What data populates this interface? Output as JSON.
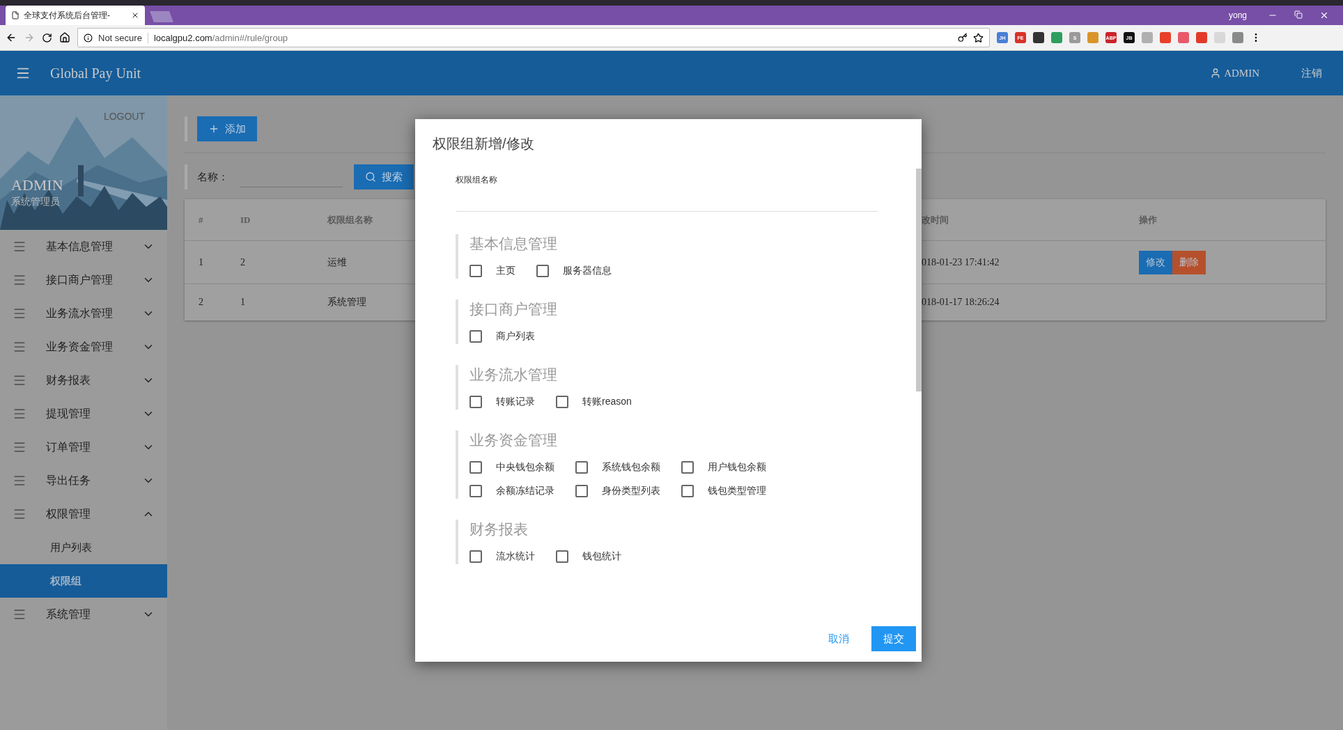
{
  "browser": {
    "tab_title": "全球支付系统后台管理-",
    "security": "Not secure",
    "url_host": "localgpu2.com",
    "url_path": "/admin#/rule/group",
    "profile": "yong",
    "extensions": [
      {
        "text": "JH",
        "color": "#4a7fd6"
      },
      {
        "text": "FE",
        "color": "#d8322a"
      },
      {
        "color": "#333333"
      },
      {
        "color": "#2e9e5e"
      },
      {
        "text": "S",
        "color": "#9a9a9a"
      },
      {
        "color": "#d9952b"
      },
      {
        "text": "ABP",
        "color": "#c9252b"
      },
      {
        "text": "JB",
        "color": "#111111"
      },
      {
        "color": "#b0b0b0"
      },
      {
        "color": "#e8402a"
      },
      {
        "color": "#e85a6a"
      },
      {
        "color": "#e23a2a"
      },
      {
        "color": "#d8d8d8"
      },
      {
        "color": "#8a8a8a"
      }
    ]
  },
  "header": {
    "title": "Global Pay Unit",
    "user": "ADMIN",
    "logout": "注销"
  },
  "profile": {
    "logout": "LOGOUT",
    "name": "ADMIN",
    "role": "系统管理员"
  },
  "sidebar": {
    "items": [
      {
        "label": "基本信息管理",
        "expanded": false
      },
      {
        "label": "接口商户管理",
        "expanded": false
      },
      {
        "label": "业务流水管理",
        "expanded": false
      },
      {
        "label": "业务资金管理",
        "expanded": false
      },
      {
        "label": "财务报表",
        "expanded": false
      },
      {
        "label": "提现管理",
        "expanded": false
      },
      {
        "label": "订单管理",
        "expanded": false
      },
      {
        "label": "导出任务",
        "expanded": false
      },
      {
        "label": "权限管理",
        "expanded": true,
        "children": [
          {
            "label": "用户列表",
            "selected": false
          },
          {
            "label": "权限组",
            "selected": true
          }
        ]
      },
      {
        "label": "系统管理",
        "expanded": false
      }
    ]
  },
  "toolbar": {
    "add_button": "添加",
    "search_label": "名称：",
    "search_button": "搜索"
  },
  "table": {
    "columns": [
      "#",
      "ID",
      "权限组名称",
      "改时间",
      "操作"
    ],
    "rows": [
      {
        "cells": [
          "1",
          "2",
          "运维",
          "018-01-23 17:41:42"
        ],
        "actions": [
          {
            "label": "修改",
            "kind": "edit"
          },
          {
            "label": "删除",
            "kind": "delete"
          }
        ]
      },
      {
        "cells": [
          "2",
          "1",
          "系统管理",
          "018-01-17 18:26:24"
        ]
      }
    ]
  },
  "dialog": {
    "title": "权限组新增/修改",
    "name_label": "权限组名称",
    "groups": [
      {
        "title": "基本信息管理",
        "options": [
          {
            "label": "主页",
            "checked": false
          },
          {
            "label": "服务器信息",
            "checked": false
          }
        ]
      },
      {
        "title": "接口商户管理",
        "options": [
          {
            "label": "商户列表",
            "checked": false
          }
        ]
      },
      {
        "title": "业务流水管理",
        "options": [
          {
            "label": "转账记录",
            "checked": false
          },
          {
            "label": "转账reason",
            "checked": false
          }
        ]
      },
      {
        "title": "业务资金管理",
        "options": [
          {
            "label": "中央钱包余额",
            "checked": false
          },
          {
            "label": "系统钱包余额",
            "checked": false
          },
          {
            "label": "用户钱包余额",
            "checked": false
          },
          {
            "label": "余额冻结记录",
            "checked": false
          },
          {
            "label": "身份类型列表",
            "checked": false
          },
          {
            "label": "钱包类型管理",
            "checked": false
          }
        ]
      },
      {
        "title": "财务报表",
        "options": [
          {
            "label": "流水统计",
            "checked": false
          },
          {
            "label": "钱包统计",
            "checked": false
          }
        ]
      }
    ],
    "cancel": "取消",
    "submit": "提交"
  }
}
